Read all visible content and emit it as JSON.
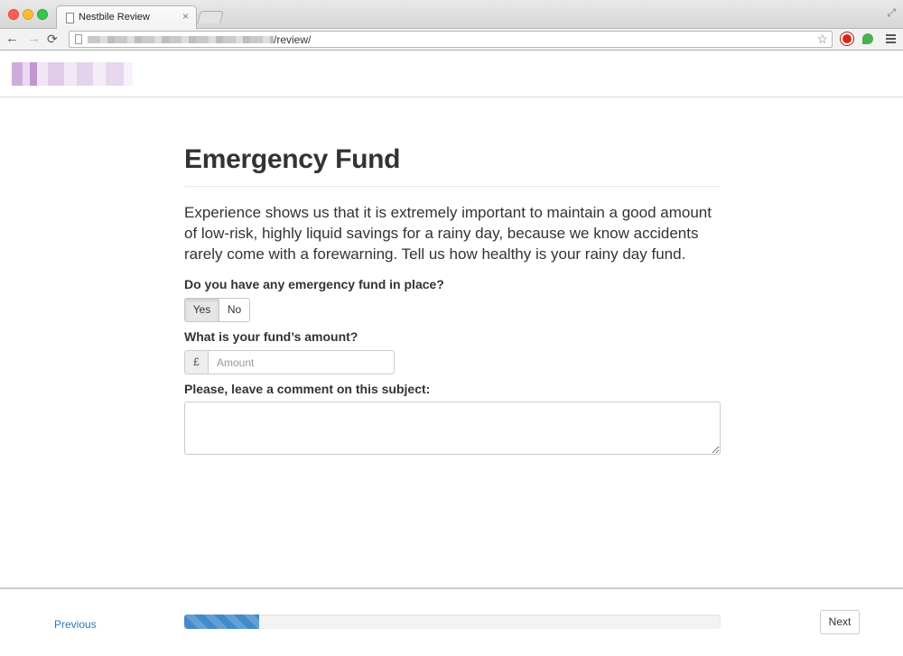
{
  "browser": {
    "tab_title": "Nestbile Review",
    "tab_close": "×",
    "url_path": "/review/",
    "back_glyph": "←",
    "forward_glyph": "→",
    "reload_glyph": "⟳",
    "star_glyph": "☆",
    "fullscreen_glyph": "⤢"
  },
  "page": {
    "title": "Emergency Fund",
    "lead": "Experience shows us that it is extremely important to maintain a good amount of low-risk, highly liquid savings for a rainy day, because we know accidents rarely come with a forewarning. Tell us how healthy is your rainy day fund.",
    "question_fund_in_place": "Do you have any emergency fund in place?",
    "option_yes": "Yes",
    "option_no": "No",
    "selected_option": "Yes",
    "question_amount": "What is your fund’s amount?",
    "currency_symbol": "£",
    "amount_placeholder": "Amount",
    "amount_value": "",
    "question_comment": "Please, leave a comment on this subject:",
    "comment_value": ""
  },
  "footer": {
    "previous_label": "Previous",
    "next_label": "Next",
    "progress_fraction": 0.14
  },
  "colors": {
    "link": "#2a7ab8",
    "progress_bar": "#428bca"
  },
  "icons": {
    "page_icon": "document-icon",
    "star": "bookmark-star-icon",
    "extension_1": "stop-sign-icon",
    "extension_2": "green-leaf-icon",
    "menu": "hamburger-menu-icon"
  }
}
